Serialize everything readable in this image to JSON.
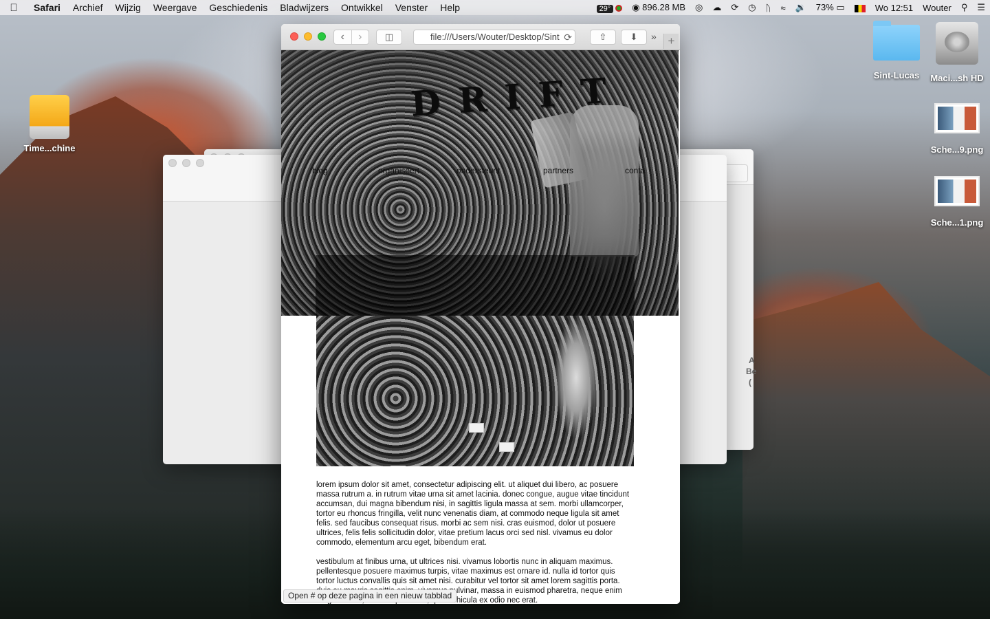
{
  "menubar": {
    "app": "Safari",
    "items": [
      "Archief",
      "Wijzig",
      "Weergave",
      "Geschiedenis",
      "Bladwijzers",
      "Ontwikkel",
      "Venster",
      "Help"
    ],
    "temperature": "29°",
    "memory": "896.28 MB",
    "battery": "73%",
    "clock": "Wo 12:51",
    "user": "Wouter"
  },
  "desktop": {
    "icons": [
      {
        "label": "Time...chine",
        "type": "drive-icon"
      },
      {
        "label": "Sint-Lucas",
        "type": "folder-icon"
      },
      {
        "label": "Maci...sh HD",
        "type": "hard-disk-icon"
      },
      {
        "label": "Sche...9.png",
        "type": "image-file-icon"
      },
      {
        "label": "Sche...1.png",
        "type": "image-file-icon"
      }
    ]
  },
  "background_window": {
    "partial_text_1": "A",
    "partial_text_2": "Be",
    "partial_text_3": "("
  },
  "safari": {
    "address": "file:///Users/Wouter/Desktop/Sint",
    "status_text": "Open # op deze pagina in een nieuw tabblad"
  },
  "site": {
    "logo": "DRIFT",
    "nav": [
      "blog",
      "organiseert",
      "ondersteunt",
      "partners",
      "conta"
    ],
    "paragraphs": [
      "lorem ipsum dolor sit amet, consectetur adipiscing elit. ut aliquet dui libero, ac posuere massa rutrum a. in rutrum vitae urna sit amet lacinia. donec congue, augue vitae tincidunt accumsan, dui magna bibendum nisi, in sagittis ligula massa at sem. morbi ullamcorper, tortor eu rhoncus fringilla, velit nunc venenatis diam, at commodo neque ligula sit amet felis. sed faucibus consequat risus. morbi ac sem nisi. cras euismod, dolor ut posuere ultrices, felis felis sollicitudin dolor, vitae pretium lacus orci sed nisl. vivamus eu dolor commodo, elementum arcu eget, bibendum erat.",
      "vestibulum at finibus urna, ut ultrices nisi. vivamus lobortis nunc in aliquam maximus. pellentesque posuere maximus turpis, vitae maximus est ornare id. nulla id tortor quis tortor luctus convallis quis sit amet nisi. curabitur vel tortor sit amet lorem sagittis porta. duis eu mauris sagittis enim. vivamus pulvinar, massa in euismod pharetra, neque enim fringilla lacus, vel volutpat lacus, quis vehicula ex odio nec erat."
    ]
  }
}
